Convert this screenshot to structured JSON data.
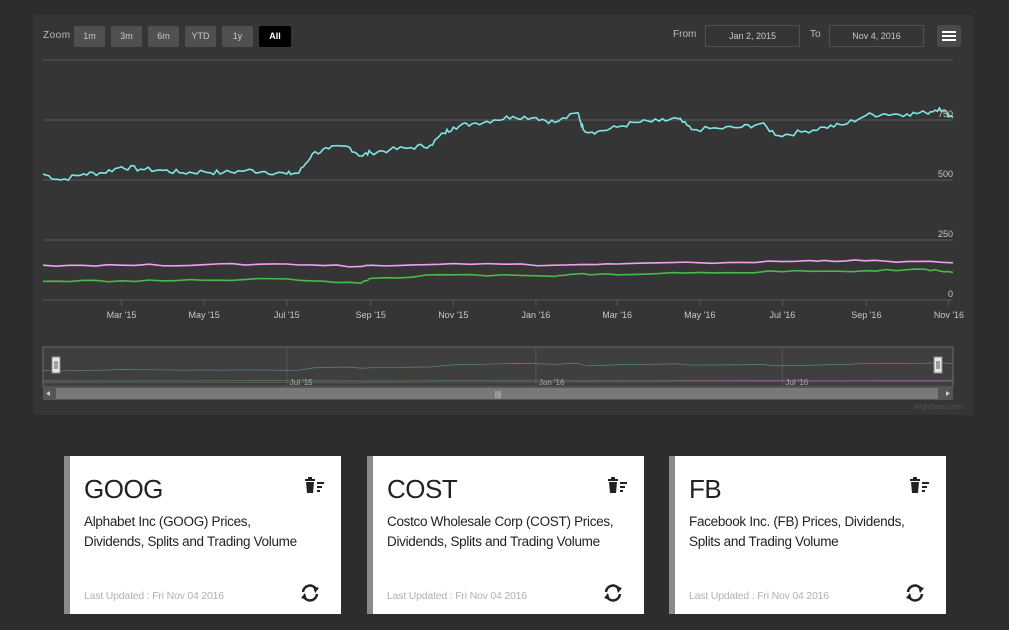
{
  "toolbar": {
    "zoom_label": "Zoom",
    "zoom_buttons": [
      "1m",
      "3m",
      "6m",
      "YTD",
      "1y",
      "All"
    ],
    "active_zoom": "All",
    "from_label": "From",
    "from_value": "Jan 2, 2015",
    "to_label": "To",
    "to_value": "Nov 4, 2016"
  },
  "credits": "Highcharts.com",
  "navigator": {
    "labels": [
      "Jul '15",
      "Jan '16",
      "Jul '16"
    ],
    "scroll_grip": "|||"
  },
  "chart_data": {
    "type": "line",
    "x_range": [
      "2015-01-02",
      "2016-11-04"
    ],
    "x_tick_labels": [
      "Mar '15",
      "May '15",
      "Jul '15",
      "Sep '15",
      "Nov '15",
      "Jan '16",
      "Mar '16",
      "May '16",
      "Jul '16",
      "Sep '16",
      "Nov '16"
    ],
    "y_tick_labels": [
      "0",
      "250",
      "500",
      "750"
    ],
    "ylim": [
      0,
      1000
    ],
    "grid": true,
    "colors": [
      "#7fe6e6",
      "#f0a0f0",
      "#4bb84b"
    ],
    "series": [
      {
        "color": "#7fe6e6",
        "x": [
          "2015-01-02",
          "2015-01-15",
          "2015-02-01",
          "2015-02-15",
          "2015-03-01",
          "2015-03-15",
          "2015-04-01",
          "2015-04-15",
          "2015-05-01",
          "2015-05-15",
          "2015-06-01",
          "2015-06-15",
          "2015-07-01",
          "2015-07-10",
          "2015-07-20",
          "2015-08-01",
          "2015-08-15",
          "2015-08-25",
          "2015-09-01",
          "2015-09-15",
          "2015-10-01",
          "2015-10-15",
          "2015-10-25",
          "2015-11-01",
          "2015-11-15",
          "2015-12-01",
          "2015-12-15",
          "2016-01-01",
          "2016-01-15",
          "2016-02-01",
          "2016-02-05",
          "2016-02-15",
          "2016-03-01",
          "2016-03-15",
          "2016-04-01",
          "2016-04-15",
          "2016-04-25",
          "2016-05-15",
          "2016-06-01",
          "2016-06-15",
          "2016-06-28",
          "2016-07-15",
          "2016-08-01",
          "2016-08-15",
          "2016-09-01",
          "2016-09-15",
          "2016-10-01",
          "2016-10-15",
          "2016-10-25",
          "2016-11-04"
        ],
        "y": [
          525,
          500,
          525,
          530,
          555,
          545,
          540,
          530,
          535,
          530,
          540,
          535,
          525,
          530,
          610,
          630,
          640,
          600,
          615,
          625,
          635,
          645,
          695,
          720,
          735,
          750,
          765,
          760,
          740,
          780,
          710,
          700,
          720,
          740,
          745,
          755,
          710,
          715,
          720,
          735,
          685,
          700,
          720,
          730,
          770,
          775,
          775,
          780,
          800,
          760
        ]
      },
      {
        "color": "#f0a0f0",
        "x": [
          "2015-01-02",
          "2015-03-01",
          "2015-05-01",
          "2015-07-01",
          "2015-08-25",
          "2015-09-01",
          "2015-11-01",
          "2016-01-15",
          "2016-03-01",
          "2016-05-01",
          "2016-07-01",
          "2016-08-01",
          "2016-09-15",
          "2016-11-04"
        ],
        "y": [
          145,
          145,
          147,
          150,
          140,
          145,
          152,
          145,
          150,
          155,
          160,
          165,
          162,
          155
        ]
      },
      {
        "color": "#4bb84b",
        "x": [
          "2015-01-02",
          "2015-03-01",
          "2015-05-01",
          "2015-07-01",
          "2015-08-25",
          "2015-09-01",
          "2015-11-01",
          "2016-01-15",
          "2016-02-05",
          "2016-03-01",
          "2016-05-01",
          "2016-07-01",
          "2016-09-01",
          "2016-10-15",
          "2016-11-04"
        ],
        "y": [
          78,
          80,
          82,
          88,
          70,
          90,
          105,
          98,
          110,
          105,
          115,
          118,
          122,
          128,
          115
        ]
      }
    ]
  },
  "cards": [
    {
      "ticker": "GOOG",
      "description": "Alphabet Inc (GOOG) Prices, Dividends, Splits and Trading Volume",
      "updated": "Last Updated : Fri Nov 04 2016"
    },
    {
      "ticker": "COST",
      "description": "Costco Wholesale Corp (COST) Prices, Dividends, Splits and Trading Volume",
      "updated": "Last Updated : Fri Nov 04 2016"
    },
    {
      "ticker": "FB",
      "description": "Facebook Inc. (FB) Prices, Dividends, Splits and Trading Volume",
      "updated": "Last Updated : Fri Nov 04 2016"
    }
  ],
  "icons": {
    "trash": "trash-icon",
    "refresh": "refresh-icon",
    "menu": "hamburger-menu-icon"
  }
}
